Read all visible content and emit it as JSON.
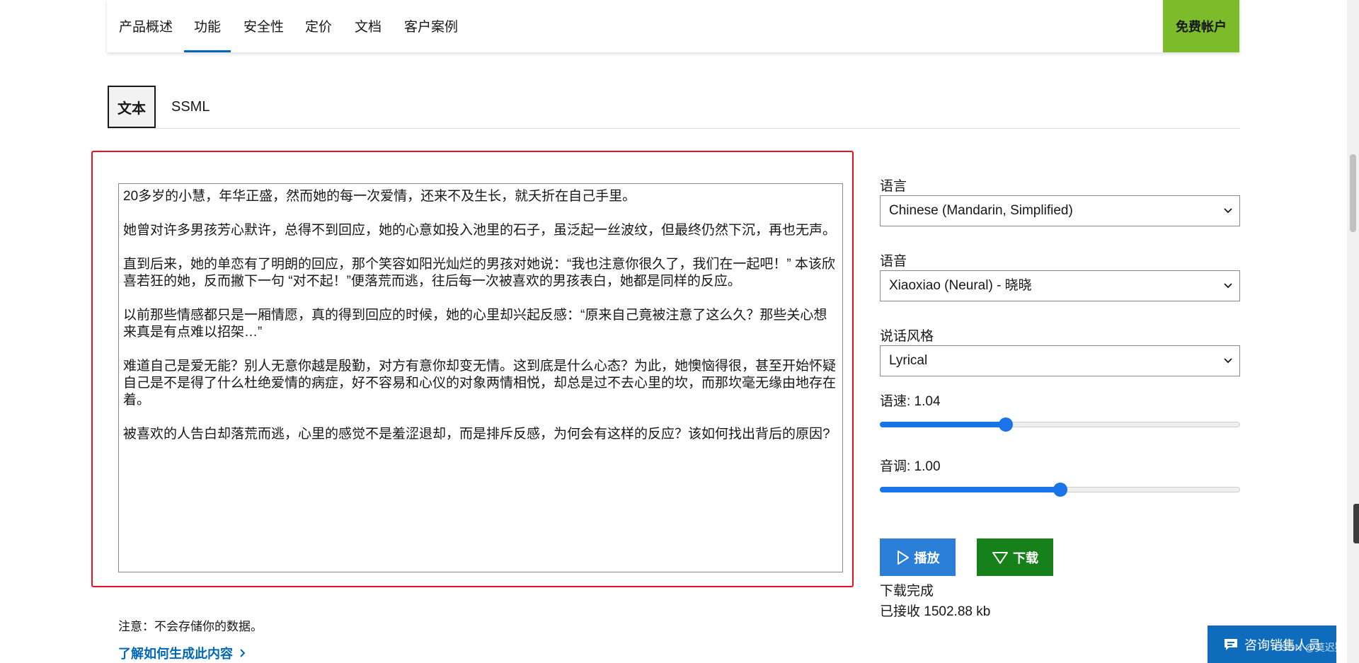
{
  "nav": {
    "items": [
      {
        "label": "产品概述"
      },
      {
        "label": "功能",
        "active": true
      },
      {
        "label": "安全性"
      },
      {
        "label": "定价"
      },
      {
        "label": "文档"
      },
      {
        "label": "客户案例"
      }
    ],
    "free_account": "免费帐户"
  },
  "tabs": {
    "text": "文本",
    "ssml": "SSML"
  },
  "input": {
    "paragraphs": [
      "20多岁的小慧，年华正盛，然而她的每一次爱情，还来不及生长，就夭折在自己手里。",
      "她曾对许多男孩芳心默许，总得不到回应，她的心意如投入池里的石子，虽泛起一丝波纹，但最终仍然下沉，再也无声。",
      "直到后来，她的单恋有了明朗的回应，那个笑容如阳光灿烂的男孩对她说：“我也注意你很久了，我们在一起吧！” 本该欣喜若狂的她，反而撇下一句 “对不起！”便落荒而逃，往后每一次被喜欢的男孩表白，她都是同样的反应。",
      "以前那些情感都只是一厢情愿，真的得到回应的时候，她的心里却兴起反感：“原来自己竟被注意了这么久？那些关心想来真是有点难以招架…”",
      "难道自己是爱无能？别人无意你越是殷勤，对方有意你却变无情。这到底是什么心态？为此，她懊恼得很，甚至开始怀疑自己是不是得了什么杜绝爱情的病症，好不容易和心仪的对象两情相悦，却总是过不去心里的坎，而那坎毫无缘由地存在着。",
      "被喜欢的人告白却落荒而逃，心里的感觉不是羞涩退却，而是排斥反感，为何会有这样的反应？该如何找出背后的原因?"
    ]
  },
  "settings": {
    "language_label": "语言",
    "language_value": "Chinese (Mandarin, Simplified)",
    "voice_label": "语音",
    "voice_value": "Xiaoxiao (Neural) - 晓晓",
    "style_label": "说话风格",
    "style_value": "Lyrical",
    "speed_label": "语速: 1.04",
    "speed_fraction": 0.35,
    "pitch_label": "音调: 1.00",
    "pitch_fraction": 0.5
  },
  "actions": {
    "play": "播放",
    "download": "下载"
  },
  "status": {
    "done": "下载完成",
    "received": "已接收 1502.88 kb"
  },
  "footer": {
    "note": "注意：不会存储你的数据。",
    "learn_more": "了解如何生成此内容"
  },
  "contact": {
    "label": "咨询销售人员",
    "watermark": "CSDN @莫迟疑"
  },
  "colors": {
    "accent": "#0067b8",
    "free_button": "#7cbb2a",
    "highlight": "#e81123",
    "play": "#2b7fd6",
    "download": "#16801b",
    "slider": "#1a73e8"
  }
}
